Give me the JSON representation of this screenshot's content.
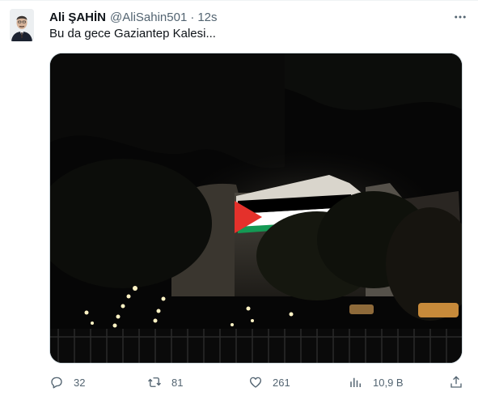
{
  "tweet": {
    "author_name": "Ali ŞAHİN",
    "handle": "@AliSahin501",
    "separator": "·",
    "time": "12s",
    "more_label": "···",
    "text": "Bu da gece Gaziantep Kalesi...",
    "media_icon": "photo",
    "actions": {
      "reply_count": "32",
      "retweet_count": "81",
      "like_count": "261",
      "views_count": "10,9 B"
    }
  },
  "icons": {
    "reply": "speech-bubble-icon",
    "retweet": "retweet-icon",
    "like": "heart-icon",
    "views": "bar-chart-icon",
    "share": "share-icon",
    "more": "more-icon"
  },
  "colors": {
    "text_primary": "#0f1419",
    "text_secondary": "#536471",
    "border": "#cfd9de",
    "flag_black": "#000000",
    "flag_white": "#ffffff",
    "flag_green": "#149954",
    "flag_red": "#e4312b"
  }
}
